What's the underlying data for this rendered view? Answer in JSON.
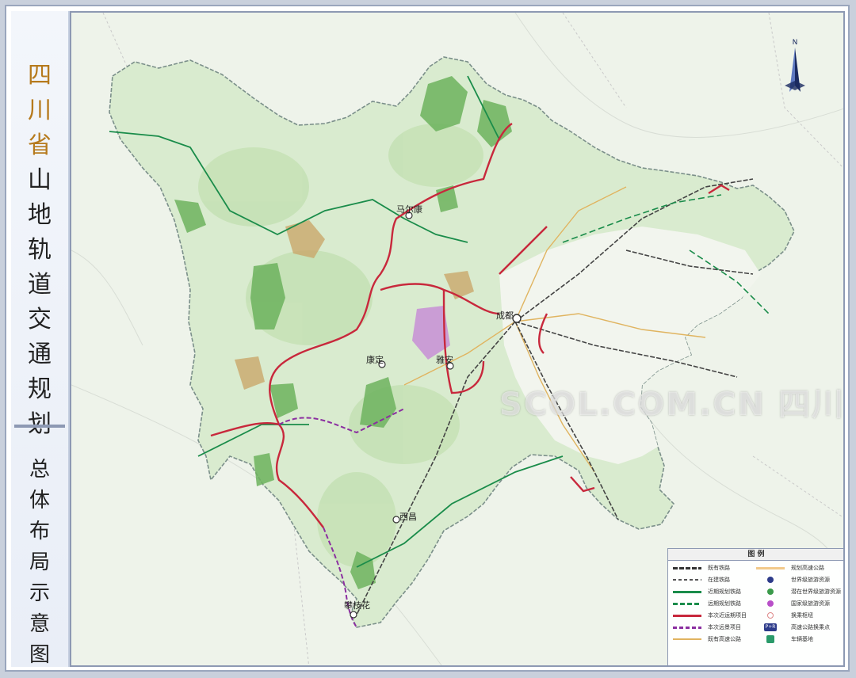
{
  "title": {
    "main_chars": [
      "四",
      "川",
      "省",
      "山",
      "地",
      "轨",
      "道",
      "交",
      "通",
      "规",
      "划"
    ],
    "sub_chars": [
      "总",
      "体",
      "布",
      "局",
      "示",
      "意",
      "图"
    ]
  },
  "map": {
    "compass_letter": "N",
    "cities": [
      {
        "name": "成都"
      },
      {
        "name": "康定"
      },
      {
        "name": "西昌"
      },
      {
        "name": "攀枝花"
      },
      {
        "name": "雅安"
      },
      {
        "name": "马尔康"
      }
    ],
    "watermark": "SCOL.COM.CN 四川在线",
    "colors": {
      "province_fill": "#d9ebcf",
      "mountain_fill": "#bfe0ae",
      "forest": "#6db35e",
      "existing_railway": "#333333",
      "planned_near": "#1a8c4a",
      "this_project": "#c8283c",
      "this_dashed": "#8b2fa0",
      "highway": "#e0b460",
      "planned_highway": "#f2c98a"
    }
  },
  "legend": {
    "title": "图 例",
    "items": [
      {
        "label": "既有铁路",
        "icon": "existing-railway-line"
      },
      {
        "label": "规划高速公路",
        "icon": "planned-highway-line"
      },
      {
        "label": "在建铁路",
        "icon": "under-construction-railway-line"
      },
      {
        "label": "世界级旅游资源",
        "icon": "world-class-tourism-dot"
      },
      {
        "label": "近期规划铁路",
        "icon": "near-term-planned-railway-line"
      },
      {
        "label": "潜在世界级旅游资源",
        "icon": "potential-world-tourism-dot"
      },
      {
        "label": "远期规划铁路",
        "icon": "long-term-planned-railway-line"
      },
      {
        "label": "国家级旅游资源",
        "icon": "national-tourism-dot"
      },
      {
        "label": "本次近运期项目",
        "icon": "this-near-term-project-line"
      },
      {
        "label": "换乘枢纽",
        "icon": "transfer-hub-dot"
      },
      {
        "label": "本次远景项目",
        "icon": "this-long-term-project-line"
      },
      {
        "label": "高速公路换乘点",
        "icon": "highway-transfer-point-box",
        "badge": "P+R"
      },
      {
        "label": "既有高速公路",
        "icon": "existing-highway-line"
      },
      {
        "label": "车辆基地",
        "icon": "vehicle-depot-box"
      }
    ]
  }
}
